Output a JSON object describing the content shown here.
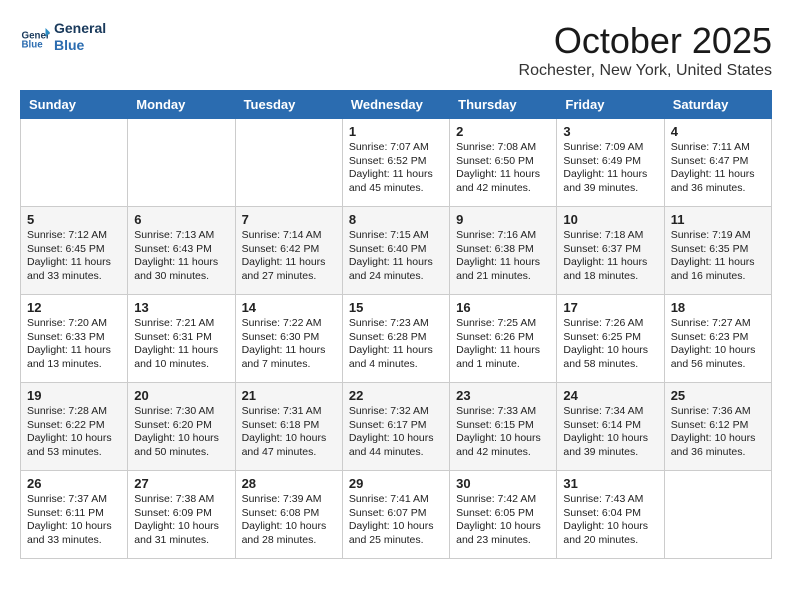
{
  "header": {
    "logo_line1": "General",
    "logo_line2": "Blue",
    "month": "October 2025",
    "location": "Rochester, New York, United States"
  },
  "weekdays": [
    "Sunday",
    "Monday",
    "Tuesday",
    "Wednesday",
    "Thursday",
    "Friday",
    "Saturday"
  ],
  "weeks": [
    [
      {
        "day": "",
        "info": ""
      },
      {
        "day": "",
        "info": ""
      },
      {
        "day": "",
        "info": ""
      },
      {
        "day": "1",
        "info": "Sunrise: 7:07 AM\nSunset: 6:52 PM\nDaylight: 11 hours and 45 minutes."
      },
      {
        "day": "2",
        "info": "Sunrise: 7:08 AM\nSunset: 6:50 PM\nDaylight: 11 hours and 42 minutes."
      },
      {
        "day": "3",
        "info": "Sunrise: 7:09 AM\nSunset: 6:49 PM\nDaylight: 11 hours and 39 minutes."
      },
      {
        "day": "4",
        "info": "Sunrise: 7:11 AM\nSunset: 6:47 PM\nDaylight: 11 hours and 36 minutes."
      }
    ],
    [
      {
        "day": "5",
        "info": "Sunrise: 7:12 AM\nSunset: 6:45 PM\nDaylight: 11 hours and 33 minutes."
      },
      {
        "day": "6",
        "info": "Sunrise: 7:13 AM\nSunset: 6:43 PM\nDaylight: 11 hours and 30 minutes."
      },
      {
        "day": "7",
        "info": "Sunrise: 7:14 AM\nSunset: 6:42 PM\nDaylight: 11 hours and 27 minutes."
      },
      {
        "day": "8",
        "info": "Sunrise: 7:15 AM\nSunset: 6:40 PM\nDaylight: 11 hours and 24 minutes."
      },
      {
        "day": "9",
        "info": "Sunrise: 7:16 AM\nSunset: 6:38 PM\nDaylight: 11 hours and 21 minutes."
      },
      {
        "day": "10",
        "info": "Sunrise: 7:18 AM\nSunset: 6:37 PM\nDaylight: 11 hours and 18 minutes."
      },
      {
        "day": "11",
        "info": "Sunrise: 7:19 AM\nSunset: 6:35 PM\nDaylight: 11 hours and 16 minutes."
      }
    ],
    [
      {
        "day": "12",
        "info": "Sunrise: 7:20 AM\nSunset: 6:33 PM\nDaylight: 11 hours and 13 minutes."
      },
      {
        "day": "13",
        "info": "Sunrise: 7:21 AM\nSunset: 6:31 PM\nDaylight: 11 hours and 10 minutes."
      },
      {
        "day": "14",
        "info": "Sunrise: 7:22 AM\nSunset: 6:30 PM\nDaylight: 11 hours and 7 minutes."
      },
      {
        "day": "15",
        "info": "Sunrise: 7:23 AM\nSunset: 6:28 PM\nDaylight: 11 hours and 4 minutes."
      },
      {
        "day": "16",
        "info": "Sunrise: 7:25 AM\nSunset: 6:26 PM\nDaylight: 11 hours and 1 minute."
      },
      {
        "day": "17",
        "info": "Sunrise: 7:26 AM\nSunset: 6:25 PM\nDaylight: 10 hours and 58 minutes."
      },
      {
        "day": "18",
        "info": "Sunrise: 7:27 AM\nSunset: 6:23 PM\nDaylight: 10 hours and 56 minutes."
      }
    ],
    [
      {
        "day": "19",
        "info": "Sunrise: 7:28 AM\nSunset: 6:22 PM\nDaylight: 10 hours and 53 minutes."
      },
      {
        "day": "20",
        "info": "Sunrise: 7:30 AM\nSunset: 6:20 PM\nDaylight: 10 hours and 50 minutes."
      },
      {
        "day": "21",
        "info": "Sunrise: 7:31 AM\nSunset: 6:18 PM\nDaylight: 10 hours and 47 minutes."
      },
      {
        "day": "22",
        "info": "Sunrise: 7:32 AM\nSunset: 6:17 PM\nDaylight: 10 hours and 44 minutes."
      },
      {
        "day": "23",
        "info": "Sunrise: 7:33 AM\nSunset: 6:15 PM\nDaylight: 10 hours and 42 minutes."
      },
      {
        "day": "24",
        "info": "Sunrise: 7:34 AM\nSunset: 6:14 PM\nDaylight: 10 hours and 39 minutes."
      },
      {
        "day": "25",
        "info": "Sunrise: 7:36 AM\nSunset: 6:12 PM\nDaylight: 10 hours and 36 minutes."
      }
    ],
    [
      {
        "day": "26",
        "info": "Sunrise: 7:37 AM\nSunset: 6:11 PM\nDaylight: 10 hours and 33 minutes."
      },
      {
        "day": "27",
        "info": "Sunrise: 7:38 AM\nSunset: 6:09 PM\nDaylight: 10 hours and 31 minutes."
      },
      {
        "day": "28",
        "info": "Sunrise: 7:39 AM\nSunset: 6:08 PM\nDaylight: 10 hours and 28 minutes."
      },
      {
        "day": "29",
        "info": "Sunrise: 7:41 AM\nSunset: 6:07 PM\nDaylight: 10 hours and 25 minutes."
      },
      {
        "day": "30",
        "info": "Sunrise: 7:42 AM\nSunset: 6:05 PM\nDaylight: 10 hours and 23 minutes."
      },
      {
        "day": "31",
        "info": "Sunrise: 7:43 AM\nSunset: 6:04 PM\nDaylight: 10 hours and 20 minutes."
      },
      {
        "day": "",
        "info": ""
      }
    ]
  ]
}
